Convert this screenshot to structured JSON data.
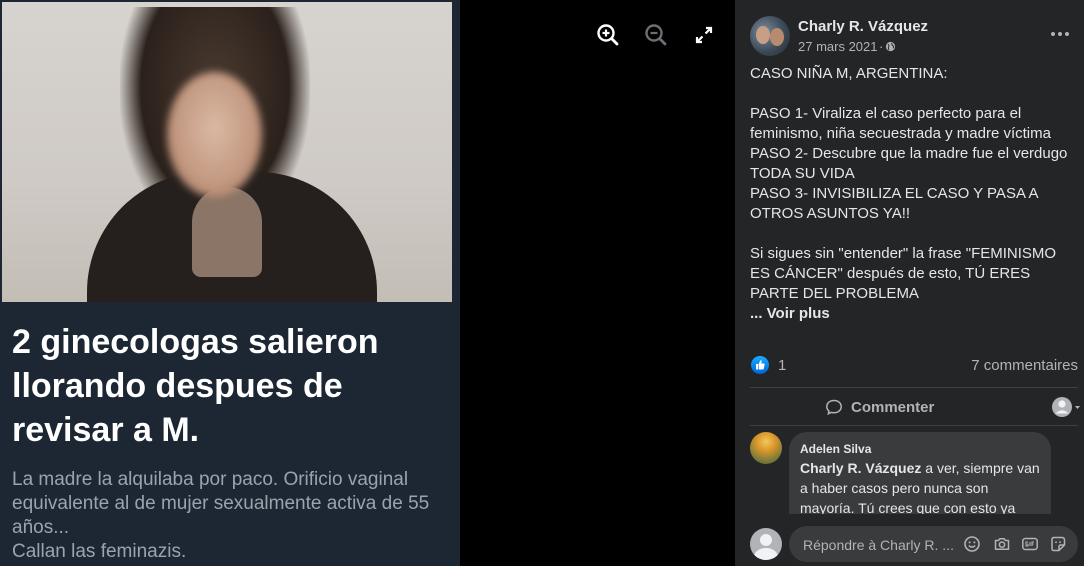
{
  "image_card": {
    "headline": "2 ginecologas salieron llorando despues de revisar a M.",
    "caption_lines": [
      "La madre la alquilaba por paco. Orificio vaginal",
      "equivalente al de mujer sexualmente activa de 55",
      "años...",
      "Callan las feminazis."
    ]
  },
  "viewer_controls": {
    "zoom_in_icon": "zoom-in-icon",
    "zoom_out_icon": "zoom-out-icon",
    "fullscreen_icon": "fullscreen-icon"
  },
  "post": {
    "author": "Charly R. Vázquez",
    "date": "27 mars 2021",
    "date_separator": "·",
    "paragraphs": [
      [
        "CASO NIÑA M, ARGENTINA:"
      ],
      [
        "PASO 1- Viraliza el caso perfecto para el feminismo, niña secuestrada y madre víctima",
        "PASO 2- Descubre que la madre fue el verdugo TODA SU VIDA",
        "PASO 3- INVISIBILIZA EL CASO Y PASA A OTROS ASUNTOS YA!!"
      ],
      [
        "Si sigues sin \"entender\" la frase \"FEMINISMO ES CÁNCER\" después de esto, TÚ ERES PARTE DEL PROBLEMA"
      ]
    ],
    "see_more": "... Voir plus",
    "reactions_count": "1",
    "comments_count": "7 commentaires",
    "comment_action": "Commenter"
  },
  "comment": {
    "author": "Adelen Silva",
    "mention": "Charly R. Vázquez",
    "text": " a ver, siempre van a haber casos pero nunca son mayoría. Tú crees que con esto ya"
  },
  "reply": {
    "placeholder": "Répondre à Charly R. ..."
  },
  "colors": {
    "sidebar_bg": "#242526",
    "bubble_bg": "#3a3b3c",
    "text_primary": "#e4e6eb",
    "text_secondary": "#b0b3b8",
    "like_blue": "#1877f2"
  }
}
